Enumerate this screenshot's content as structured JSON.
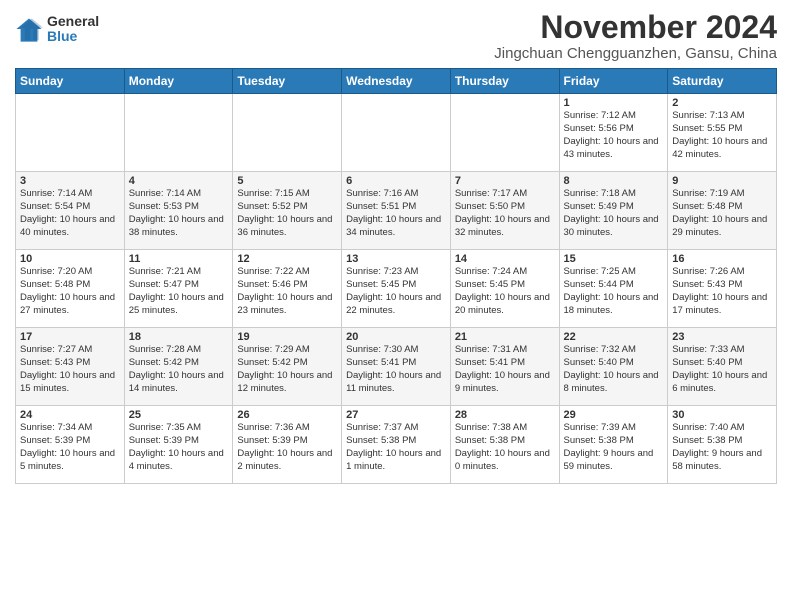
{
  "logo": {
    "general": "General",
    "blue": "Blue"
  },
  "title": "November 2024",
  "location": "Jingchuan Chengguanzhen, Gansu, China",
  "days_of_week": [
    "Sunday",
    "Monday",
    "Tuesday",
    "Wednesday",
    "Thursday",
    "Friday",
    "Saturday"
  ],
  "weeks": [
    [
      {
        "day": "",
        "info": ""
      },
      {
        "day": "",
        "info": ""
      },
      {
        "day": "",
        "info": ""
      },
      {
        "day": "",
        "info": ""
      },
      {
        "day": "",
        "info": ""
      },
      {
        "day": "1",
        "info": "Sunrise: 7:12 AM\nSunset: 5:56 PM\nDaylight: 10 hours and 43 minutes."
      },
      {
        "day": "2",
        "info": "Sunrise: 7:13 AM\nSunset: 5:55 PM\nDaylight: 10 hours and 42 minutes."
      }
    ],
    [
      {
        "day": "3",
        "info": "Sunrise: 7:14 AM\nSunset: 5:54 PM\nDaylight: 10 hours and 40 minutes."
      },
      {
        "day": "4",
        "info": "Sunrise: 7:14 AM\nSunset: 5:53 PM\nDaylight: 10 hours and 38 minutes."
      },
      {
        "day": "5",
        "info": "Sunrise: 7:15 AM\nSunset: 5:52 PM\nDaylight: 10 hours and 36 minutes."
      },
      {
        "day": "6",
        "info": "Sunrise: 7:16 AM\nSunset: 5:51 PM\nDaylight: 10 hours and 34 minutes."
      },
      {
        "day": "7",
        "info": "Sunrise: 7:17 AM\nSunset: 5:50 PM\nDaylight: 10 hours and 32 minutes."
      },
      {
        "day": "8",
        "info": "Sunrise: 7:18 AM\nSunset: 5:49 PM\nDaylight: 10 hours and 30 minutes."
      },
      {
        "day": "9",
        "info": "Sunrise: 7:19 AM\nSunset: 5:48 PM\nDaylight: 10 hours and 29 minutes."
      }
    ],
    [
      {
        "day": "10",
        "info": "Sunrise: 7:20 AM\nSunset: 5:48 PM\nDaylight: 10 hours and 27 minutes."
      },
      {
        "day": "11",
        "info": "Sunrise: 7:21 AM\nSunset: 5:47 PM\nDaylight: 10 hours and 25 minutes."
      },
      {
        "day": "12",
        "info": "Sunrise: 7:22 AM\nSunset: 5:46 PM\nDaylight: 10 hours and 23 minutes."
      },
      {
        "day": "13",
        "info": "Sunrise: 7:23 AM\nSunset: 5:45 PM\nDaylight: 10 hours and 22 minutes."
      },
      {
        "day": "14",
        "info": "Sunrise: 7:24 AM\nSunset: 5:45 PM\nDaylight: 10 hours and 20 minutes."
      },
      {
        "day": "15",
        "info": "Sunrise: 7:25 AM\nSunset: 5:44 PM\nDaylight: 10 hours and 18 minutes."
      },
      {
        "day": "16",
        "info": "Sunrise: 7:26 AM\nSunset: 5:43 PM\nDaylight: 10 hours and 17 minutes."
      }
    ],
    [
      {
        "day": "17",
        "info": "Sunrise: 7:27 AM\nSunset: 5:43 PM\nDaylight: 10 hours and 15 minutes."
      },
      {
        "day": "18",
        "info": "Sunrise: 7:28 AM\nSunset: 5:42 PM\nDaylight: 10 hours and 14 minutes."
      },
      {
        "day": "19",
        "info": "Sunrise: 7:29 AM\nSunset: 5:42 PM\nDaylight: 10 hours and 12 minutes."
      },
      {
        "day": "20",
        "info": "Sunrise: 7:30 AM\nSunset: 5:41 PM\nDaylight: 10 hours and 11 minutes."
      },
      {
        "day": "21",
        "info": "Sunrise: 7:31 AM\nSunset: 5:41 PM\nDaylight: 10 hours and 9 minutes."
      },
      {
        "day": "22",
        "info": "Sunrise: 7:32 AM\nSunset: 5:40 PM\nDaylight: 10 hours and 8 minutes."
      },
      {
        "day": "23",
        "info": "Sunrise: 7:33 AM\nSunset: 5:40 PM\nDaylight: 10 hours and 6 minutes."
      }
    ],
    [
      {
        "day": "24",
        "info": "Sunrise: 7:34 AM\nSunset: 5:39 PM\nDaylight: 10 hours and 5 minutes."
      },
      {
        "day": "25",
        "info": "Sunrise: 7:35 AM\nSunset: 5:39 PM\nDaylight: 10 hours and 4 minutes."
      },
      {
        "day": "26",
        "info": "Sunrise: 7:36 AM\nSunset: 5:39 PM\nDaylight: 10 hours and 2 minutes."
      },
      {
        "day": "27",
        "info": "Sunrise: 7:37 AM\nSunset: 5:38 PM\nDaylight: 10 hours and 1 minute."
      },
      {
        "day": "28",
        "info": "Sunrise: 7:38 AM\nSunset: 5:38 PM\nDaylight: 10 hours and 0 minutes."
      },
      {
        "day": "29",
        "info": "Sunrise: 7:39 AM\nSunset: 5:38 PM\nDaylight: 9 hours and 59 minutes."
      },
      {
        "day": "30",
        "info": "Sunrise: 7:40 AM\nSunset: 5:38 PM\nDaylight: 9 hours and 58 minutes."
      }
    ]
  ]
}
